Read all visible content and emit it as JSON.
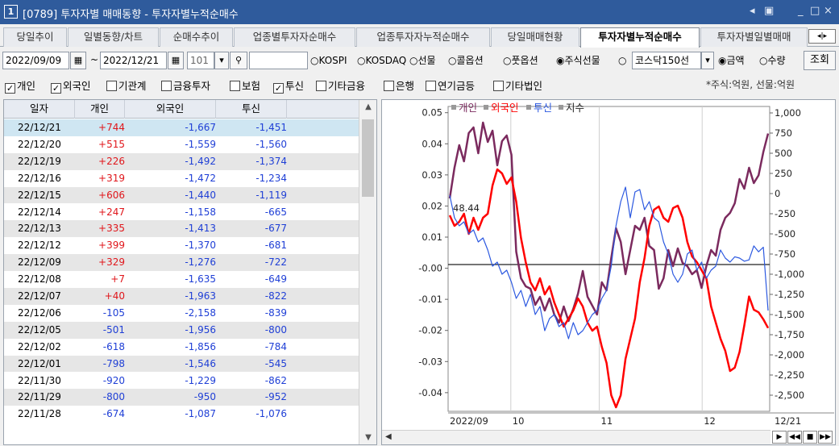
{
  "window": {
    "number": "1",
    "title": "[0789] 투자자별 매매동향 - 투자자별누적순매수",
    "controls": [
      "◂",
      "▣",
      "_",
      "□",
      "×"
    ]
  },
  "tabs": [
    {
      "label": "당일추이",
      "active": false
    },
    {
      "label": "일별동향/차트",
      "active": false
    },
    {
      "label": "순매수추이",
      "active": false
    },
    {
      "label": "업종별투자자순매수",
      "active": false
    },
    {
      "label": "업종투자자누적순매수",
      "active": false
    },
    {
      "label": "당일매매현황",
      "active": false
    },
    {
      "label": "투자자별누적순매수",
      "active": true
    },
    {
      "label": "투자자별일별매매",
      "active": false
    }
  ],
  "tab_scroll": "◂|▸",
  "filters": {
    "start_date": "2022/09/09",
    "tilde": "~",
    "end_date": "2022/12/21",
    "code": "101",
    "code_name": "",
    "market_options": [
      {
        "label": "KOSPI",
        "selected": false
      },
      {
        "label": "KOSDAQ",
        "selected": false
      },
      {
        "label": "선물",
        "selected": false
      },
      {
        "label": "콜옵션",
        "selected": false
      },
      {
        "label": "풋옵션",
        "selected": false
      },
      {
        "label": "주식선물",
        "selected": true
      }
    ],
    "kosdaq150": "코스닥150선",
    "value_options": [
      {
        "label": "금액",
        "selected": true
      },
      {
        "label": "수량",
        "selected": false
      }
    ],
    "query_button": "조회"
  },
  "investor_filters": [
    {
      "label": "개인",
      "checked": true
    },
    {
      "label": "외국인",
      "checked": true
    },
    {
      "label": "기관계",
      "checked": false
    },
    {
      "label": "금융투자",
      "checked": false
    },
    {
      "label": "보험",
      "checked": false
    },
    {
      "label": "투신",
      "checked": true
    },
    {
      "label": "기타금융",
      "checked": false
    },
    {
      "label": "은행",
      "checked": false
    },
    {
      "label": "연기금등",
      "checked": false
    },
    {
      "label": "기타법인",
      "checked": false
    }
  ],
  "unit_note": "*주식:억원, 선물:억원",
  "table": {
    "headers": [
      "일자",
      "개인",
      "외국인",
      "투신"
    ],
    "rows": [
      [
        "22/12/21",
        "+744",
        "-1,667",
        "-1,451"
      ],
      [
        "22/12/20",
        "+515",
        "-1,559",
        "-1,560"
      ],
      [
        "22/12/19",
        "+226",
        "-1,492",
        "-1,374"
      ],
      [
        "22/12/16",
        "+319",
        "-1,472",
        "-1,234"
      ],
      [
        "22/12/15",
        "+606",
        "-1,440",
        "-1,119"
      ],
      [
        "22/12/14",
        "+247",
        "-1,158",
        "-665"
      ],
      [
        "22/12/13",
        "+335",
        "-1,413",
        "-677"
      ],
      [
        "22/12/12",
        "+399",
        "-1,370",
        "-681"
      ],
      [
        "22/12/09",
        "+329",
        "-1,276",
        "-722"
      ],
      [
        "22/12/08",
        "+7",
        "-1,635",
        "-649"
      ],
      [
        "22/12/07",
        "+40",
        "-1,963",
        "-822"
      ],
      [
        "22/12/06",
        "-105",
        "-2,158",
        "-839"
      ],
      [
        "22/12/05",
        "-501",
        "-1,956",
        "-800"
      ],
      [
        "22/12/02",
        "-618",
        "-1,856",
        "-784"
      ],
      [
        "22/12/01",
        "-798",
        "-1,546",
        "-545"
      ],
      [
        "22/11/30",
        "-920",
        "-1,229",
        "-862"
      ],
      [
        "22/11/29",
        "-800",
        "-950",
        "-952"
      ],
      [
        "22/11/28",
        "-674",
        "-1,087",
        "-1,076"
      ]
    ]
  },
  "colors": {
    "individual": "#7b2a5e",
    "foreign": "#ff0000",
    "trust": "#2b58e0",
    "index": "#222222"
  },
  "chart_data": {
    "type": "line",
    "legend": [
      {
        "name": "개인",
        "color": "#7b2a5e"
      },
      {
        "name": "외국인",
        "color": "#ff0000"
      },
      {
        "name": "투신",
        "color": "#2b58e0"
      },
      {
        "name": "지수",
        "color": "#222222"
      }
    ],
    "legend_position": "top-left",
    "left_axis": {
      "ticks": [
        "0.05",
        "0.04",
        "0.03",
        "0.02",
        "0.01",
        "-0.00",
        "-0.01",
        "-0.02",
        "-0.03",
        "-0.04"
      ],
      "ylim": [
        -0.046,
        0.052
      ]
    },
    "right_axis": {
      "ticks": [
        "1,000",
        "750",
        "500",
        "250",
        "0",
        "-250",
        "-500",
        "-750",
        "-1,000",
        "-1,250",
        "-1,500",
        "-1,750",
        "-2,000",
        "-2,250",
        "-2,500"
      ],
      "ylim": [
        -2700,
        1080
      ]
    },
    "x_labels": [
      "2022/09",
      "10",
      "11",
      "12"
    ],
    "x_end_label": "12/21",
    "annotation": "48.44",
    "zero_line": 0,
    "series": [
      {
        "name": "개인",
        "values": [
          -60,
          320,
          600,
          400,
          750,
          820,
          500,
          880,
          640,
          780,
          350,
          650,
          720,
          480,
          -720,
          -1050,
          -1150,
          -1180,
          -1380,
          -1280,
          -1450,
          -1300,
          -1500,
          -1600,
          -1400,
          -1580,
          -1430,
          -1240,
          -960,
          -1280,
          -1390,
          -1500,
          -1100,
          -1200,
          -800,
          -430,
          -600,
          -1000,
          -700,
          -400,
          -450,
          -300,
          -650,
          -700,
          -1180,
          -1050,
          -700,
          -900,
          -680,
          -860,
          -900,
          -1000,
          -950,
          -1170,
          -900,
          -700,
          -770,
          -450,
          -300,
          -240,
          -120,
          180,
          60,
          320,
          130,
          226,
          515,
          744
        ]
      },
      {
        "name": "외국인",
        "values": [
          -270,
          -400,
          -350,
          -250,
          -500,
          -300,
          -450,
          -300,
          -250,
          100,
          300,
          250,
          120,
          200,
          -100,
          -550,
          -850,
          -1100,
          -1200,
          -1050,
          -1250,
          -1150,
          -1350,
          -1500,
          -1650,
          -1550,
          -1450,
          -1300,
          -1400,
          -1600,
          -1700,
          -1650,
          -1900,
          -2100,
          -2500,
          -2650,
          -2500,
          -2050,
          -1800,
          -1550,
          -1100,
          -800,
          -400,
          -200,
          -160,
          -300,
          -350,
          -180,
          -150,
          -300,
          -600,
          -780,
          -850,
          -950,
          -1050,
          -1400,
          -1600,
          -1800,
          -1950,
          -2200,
          -2158,
          -1963,
          -1635,
          -1276,
          -1440,
          -1472,
          -1559,
          -1667
        ]
      },
      {
        "name": "투신",
        "values": [
          -20,
          -300,
          -400,
          -350,
          -500,
          -450,
          -600,
          -550,
          -700,
          -900,
          -850,
          -1000,
          -950,
          -1100,
          -1300,
          -1200,
          -1400,
          -1250,
          -1500,
          -1400,
          -1700,
          -1550,
          -1500,
          -1650,
          -1600,
          -1800,
          -1600,
          -1750,
          -1700,
          -1600,
          -1500,
          -1450,
          -1300,
          -1200,
          -900,
          -400,
          -100,
          80,
          -300,
          20,
          50,
          -200,
          -100,
          -300,
          -350,
          -600,
          -750,
          -1000,
          -1100,
          -1000,
          -750,
          -700,
          -950,
          -850,
          -1050,
          -950,
          -900,
          -700,
          -800,
          -850,
          -784,
          -800,
          -839,
          -822,
          -649,
          -722,
          -665,
          -1451
        ]
      },
      {
        "name": "지수",
        "values": [
          0,
          0
        ]
      }
    ]
  }
}
